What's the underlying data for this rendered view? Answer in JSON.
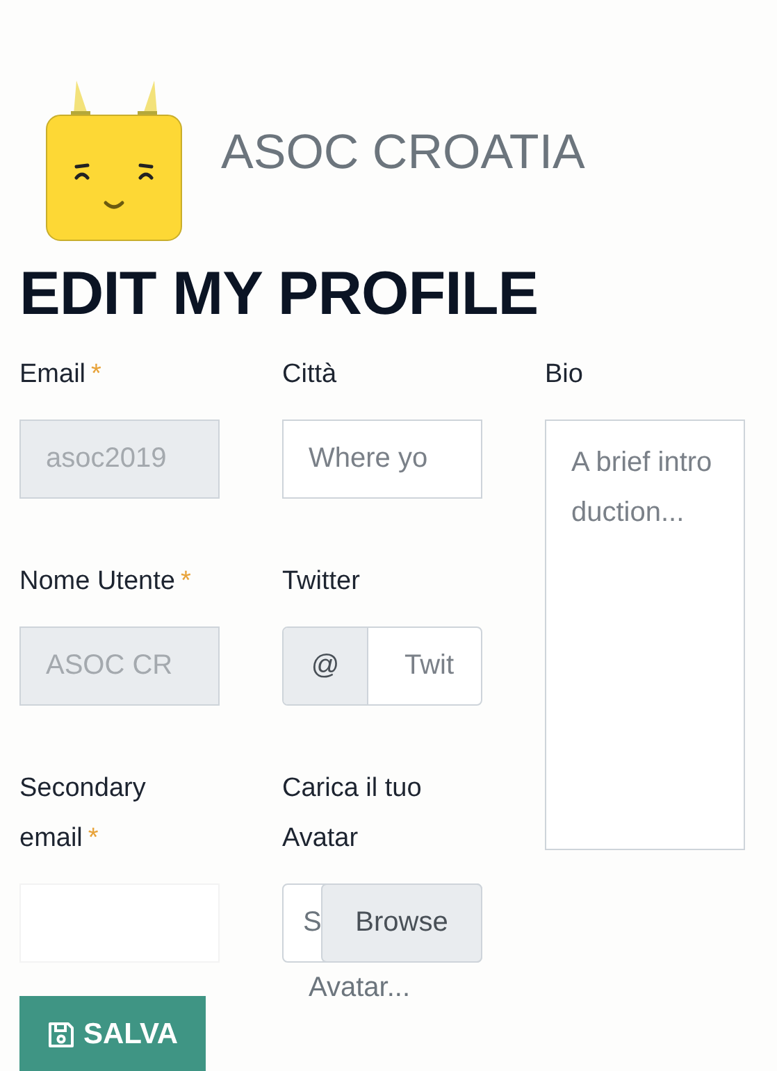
{
  "brand": {
    "name": "ASOC CROATIA"
  },
  "title": "EDIT MY PROFILE",
  "columns": [
    {
      "fields": [
        {
          "kind": "text",
          "label": "Email",
          "required_mark": "*",
          "value": "asoc2019",
          "disabled": true
        },
        {
          "kind": "text",
          "label": "Nome Utente",
          "required_mark": "*",
          "value": "ASOC CR",
          "disabled": true
        },
        {
          "kind": "text",
          "label": "Secondary email",
          "required_mark": "*",
          "disabled": false
        }
      ]
    },
    {
      "fields": [
        {
          "kind": "text",
          "label": "Città",
          "placeholder": "Where yo",
          "disabled": false
        },
        {
          "kind": "prefixed",
          "label": "Twitter",
          "prefix": "@",
          "placeholder": "Twit"
        },
        {
          "kind": "file",
          "label": "Carica il tuo Avatar",
          "shown_text": "S",
          "overflow_text": "Avatar...",
          "button": "Browse"
        }
      ]
    },
    {
      "fields": [
        {
          "kind": "textarea",
          "label": "Bio",
          "placeholder": "A brief introduction..."
        }
      ]
    }
  ],
  "save_button": {
    "label": "SALVA"
  }
}
